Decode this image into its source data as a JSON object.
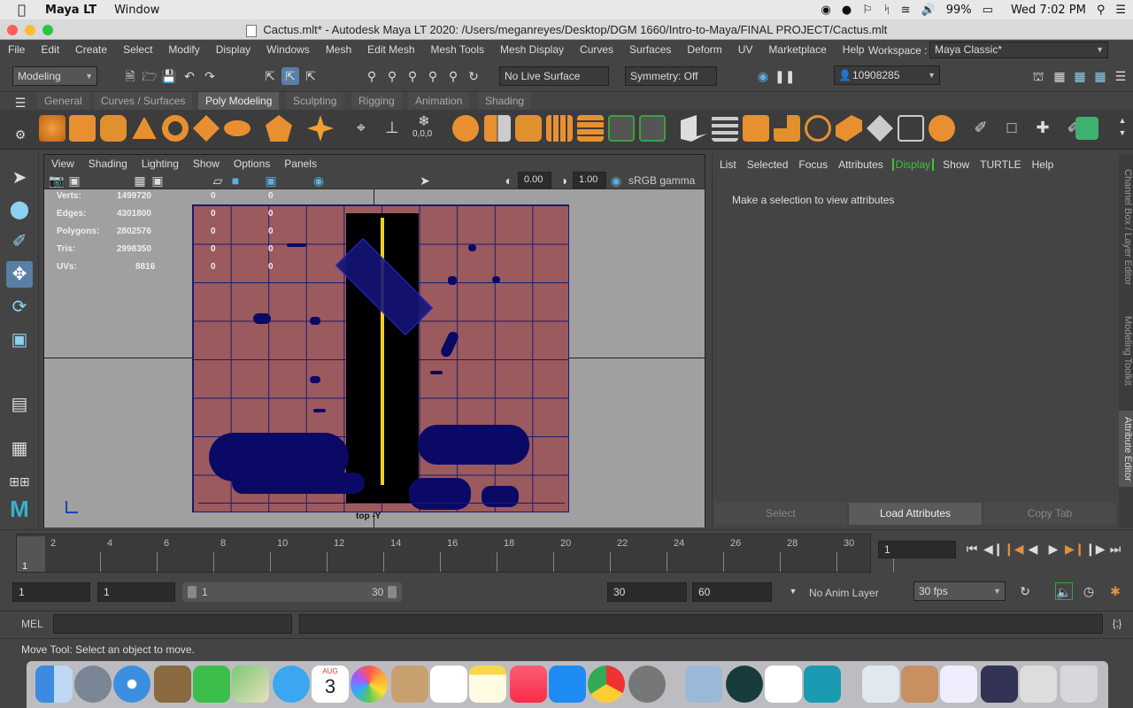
{
  "mac": {
    "app": "Maya LT",
    "menu": "Window",
    "battery": "99%",
    "clock": "Wed 7:02 PM"
  },
  "window": {
    "title": "Cactus.mlt* - Autodesk Maya LT 2020: /Users/meganreyes/Desktop/DGM 1660/Intro-to-Maya/FINAL PROJECT/Cactus.mlt"
  },
  "menubar": {
    "items": [
      "File",
      "Edit",
      "Create",
      "Select",
      "Modify",
      "Display",
      "Windows",
      "Mesh",
      "Edit Mesh",
      "Mesh Tools",
      "Mesh Display",
      "Curves",
      "Surfaces",
      "Deform",
      "UV",
      "Marketplace",
      "Help"
    ],
    "workspace_label": "Workspace :",
    "workspace_value": "Maya Classic*"
  },
  "statusline": {
    "mode": "Modeling",
    "live_surface": "No Live Surface",
    "symmetry": "Symmetry: Off",
    "user": "10908285"
  },
  "shelf": {
    "tabs": [
      "General",
      "Curves / Surfaces",
      "Poly Modeling",
      "Sculpting",
      "Rigging",
      "Animation",
      "Shading"
    ],
    "active": "Poly Modeling",
    "coord_label": "0,0,0"
  },
  "panel": {
    "menus": [
      "View",
      "Shading",
      "Lighting",
      "Show",
      "Options",
      "Panels"
    ],
    "exposure": "0.00",
    "gamma": "1.00",
    "colorspace": "sRGB gamma",
    "camera": "top -Y"
  },
  "hud": {
    "rows": [
      {
        "label": "Verts:",
        "total": "1499720",
        "sel": "0",
        "comp": "0"
      },
      {
        "label": "Edges:",
        "total": "4301800",
        "sel": "0",
        "comp": "0"
      },
      {
        "label": "Polygons:",
        "total": "2802576",
        "sel": "0",
        "comp": "0"
      },
      {
        "label": "Tris:",
        "total": "2998350",
        "sel": "0",
        "comp": "0"
      },
      {
        "label": "UVs:",
        "total": "8816",
        "sel": "0",
        "comp": "0"
      }
    ]
  },
  "attr": {
    "menus": [
      "List",
      "Selected",
      "Focus",
      "Attributes",
      "Display",
      "Show",
      "TURTLE",
      "Help"
    ],
    "message": "Make a selection to view attributes",
    "select": "Select",
    "load": "Load Attributes",
    "copy": "Copy Tab"
  },
  "sidetabs": [
    "Channel Box / Layer Editor",
    "Modeling Toolkit",
    "Attribute Editor"
  ],
  "timeline": {
    "ticks": [
      "2",
      "4",
      "6",
      "8",
      "10",
      "12",
      "14",
      "16",
      "18",
      "20",
      "22",
      "24",
      "26",
      "28",
      "30"
    ],
    "current": "1",
    "frame_field": "1"
  },
  "range": {
    "start": "1",
    "anim_start": "1",
    "range_lo": "1",
    "range_hi": "30",
    "anim_end": "30",
    "end": "60",
    "anim_layer": "No Anim Layer",
    "fps": "30 fps"
  },
  "mel": {
    "label": "MEL"
  },
  "help": {
    "text": "Move Tool: Select an object to move."
  },
  "dock": {
    "calendar_month": "AUG",
    "calendar_day": "3"
  }
}
